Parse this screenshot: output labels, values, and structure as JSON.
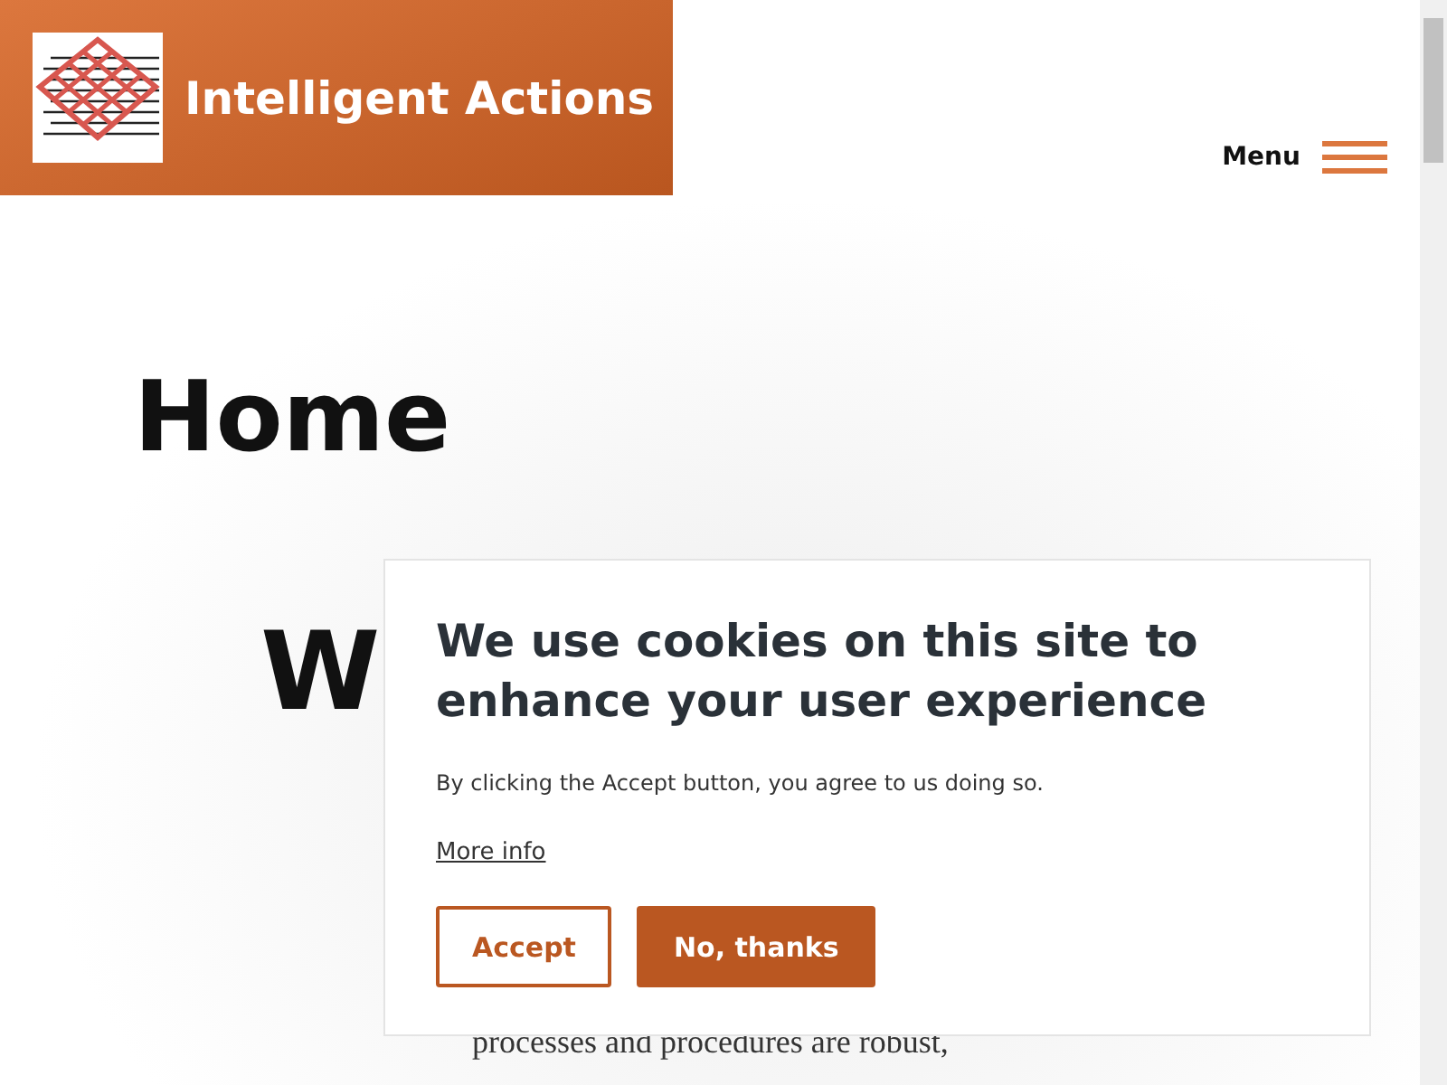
{
  "header": {
    "brand": "Intelligent Actions",
    "menu_label": "Menu"
  },
  "page": {
    "title": "Home",
    "subheading": "W",
    "paragraph": "processes and procedures are robust,"
  },
  "cookie_dialog": {
    "title": "We use cookies on this site to enhance your user experience",
    "text": "By clicking the Accept button, you agree to us doing so.",
    "link": "More info",
    "buttons": [
      {
        "label": "Accept",
        "kind": "outline"
      },
      {
        "label": "No, thanks",
        "kind": "filled"
      }
    ]
  }
}
